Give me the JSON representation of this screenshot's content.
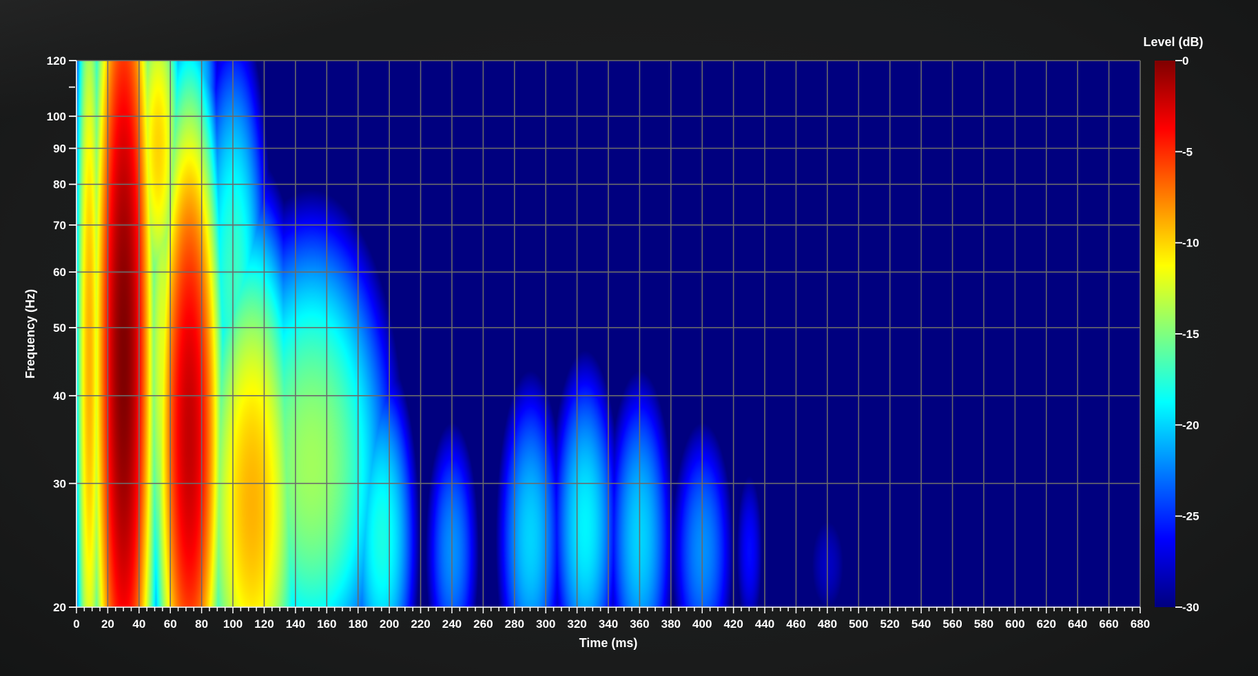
{
  "chart_data": {
    "type": "heatmap",
    "title": "",
    "xlabel": "Time (ms)",
    "ylabel": "Frequency (Hz)",
    "colorbar_label": "Level (dB)",
    "xlim": [
      0,
      680
    ],
    "ylim": [
      20,
      120
    ],
    "y_scale": "log",
    "clim": [
      -30,
      0
    ],
    "grid": true,
    "x_ticks": [
      0,
      20,
      40,
      60,
      80,
      100,
      120,
      140,
      160,
      180,
      200,
      220,
      240,
      260,
      280,
      300,
      320,
      340,
      360,
      380,
      400,
      420,
      440,
      460,
      480,
      500,
      520,
      540,
      560,
      580,
      600,
      620,
      640,
      660,
      680
    ],
    "y_ticks": [
      20,
      30,
      40,
      50,
      60,
      70,
      80,
      90,
      100,
      120
    ],
    "y_unlabeled_ticks": [
      110
    ],
    "colorbar_ticks": [
      0,
      -5,
      -10,
      -15,
      -20,
      -25,
      -30
    ],
    "colormap": [
      "#00007f",
      "#0000ff",
      "#007fff",
      "#00ffff",
      "#7fff7f",
      "#ffff00",
      "#ff7f00",
      "#ff0000",
      "#7f0000"
    ],
    "blobs": [
      {
        "t": 8,
        "f": 45,
        "w": 5,
        "h": 0.9,
        "level": -9
      },
      {
        "t": 30,
        "f": 45,
        "w": 10,
        "h": 0.85,
        "level": 0
      },
      {
        "t": 28,
        "f": 112,
        "w": 7,
        "h": 0.12,
        "level": -13
      },
      {
        "t": 52,
        "f": 90,
        "w": 9,
        "h": 0.35,
        "level": -10
      },
      {
        "t": 55,
        "f": 45,
        "w": 7,
        "h": 0.6,
        "level": -12
      },
      {
        "t": 72,
        "f": 35,
        "w": 11,
        "h": 0.6,
        "level": -2
      },
      {
        "t": 78,
        "f": 110,
        "w": 9,
        "h": 0.25,
        "level": -20
      },
      {
        "t": 100,
        "f": 58,
        "w": 14,
        "h": 0.5,
        "level": -17
      },
      {
        "t": 112,
        "f": 28,
        "w": 18,
        "h": 0.5,
        "level": -9
      },
      {
        "t": 150,
        "f": 32,
        "w": 30,
        "h": 0.45,
        "level": -14
      },
      {
        "t": 195,
        "f": 25,
        "w": 14,
        "h": 0.35,
        "level": -18
      },
      {
        "t": 240,
        "f": 24,
        "w": 12,
        "h": 0.3,
        "level": -22
      },
      {
        "t": 290,
        "f": 25,
        "w": 14,
        "h": 0.35,
        "level": -20
      },
      {
        "t": 325,
        "f": 26,
        "w": 14,
        "h": 0.35,
        "level": -19
      },
      {
        "t": 360,
        "f": 25,
        "w": 14,
        "h": 0.35,
        "level": -20
      },
      {
        "t": 400,
        "f": 24,
        "w": 14,
        "h": 0.3,
        "level": -22
      },
      {
        "t": 430,
        "f": 24,
        "w": 8,
        "h": 0.25,
        "level": -26
      },
      {
        "t": 480,
        "f": 23,
        "w": 14,
        "h": 0.2,
        "level": -28
      }
    ]
  }
}
